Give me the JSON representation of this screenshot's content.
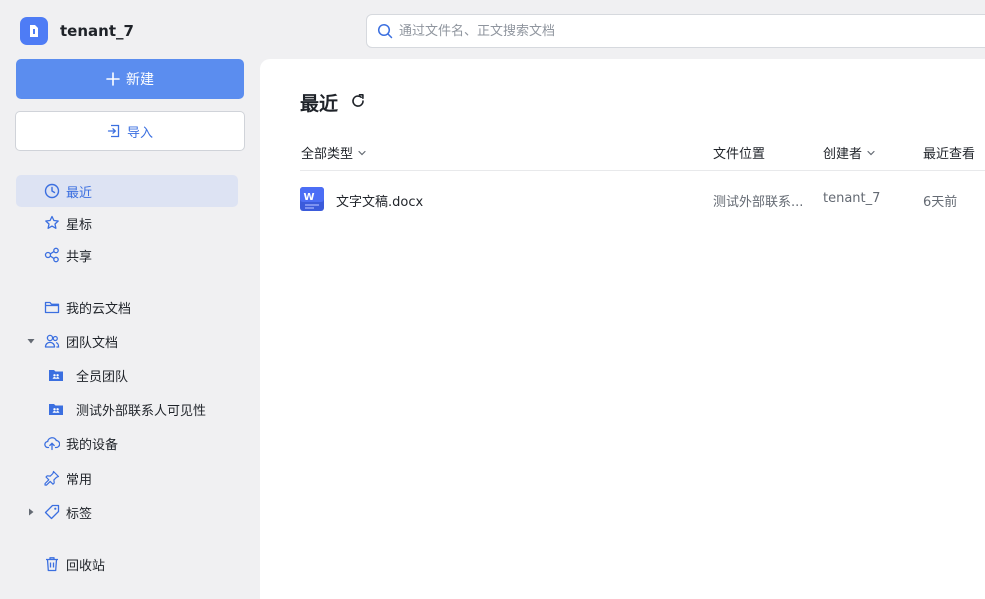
{
  "brand": {
    "name": "tenant_7"
  },
  "search": {
    "placeholder": "通过文件名、正文搜索文档"
  },
  "buttons": {
    "new_label": "新建",
    "import_label": "导入"
  },
  "nav": {
    "recent": "最近",
    "starred": "星标",
    "shared": "共享",
    "my_cloud_docs": "我的云文档",
    "team_docs": "团队文档",
    "team_all": "全员团队",
    "team_external": "测试外部联系人可见性",
    "my_devices": "我的设备",
    "frequent": "常用",
    "tags": "标签",
    "trash": "回收站"
  },
  "main": {
    "title": "最近",
    "columns": {
      "type_filter": "全部类型",
      "location": "文件位置",
      "creator": "创建者",
      "last_viewed": "最近查看"
    },
    "rows": [
      {
        "name": "文字文稿.docx",
        "location": "测试外部联系...",
        "creator": "tenant_7",
        "last_viewed": "6天前",
        "type_icon": "W"
      }
    ]
  },
  "colors": {
    "accent": "#5b8def",
    "active_bg": "#dde3f3",
    "brand_blue": "#4e7cf5"
  }
}
